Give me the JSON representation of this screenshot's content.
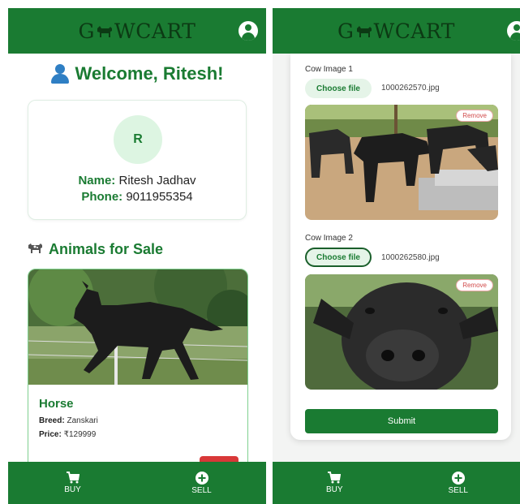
{
  "app": {
    "logo_prefix": "G",
    "logo_suffix": "WCART"
  },
  "bottom_nav": {
    "buy_label": "BUY",
    "sell_label": "SELL"
  },
  "left": {
    "welcome": "Welcome, Ritesh!",
    "profile": {
      "initial": "R",
      "name_label": "Name:",
      "name_value": "Ritesh Jadhav",
      "phone_label": "Phone:",
      "phone_value": "9011955354"
    },
    "section_title": "Animals for Sale",
    "listing": {
      "name": "Horse",
      "breed_label": "Breed:",
      "breed_value": "Zanskari",
      "price_label": "Price:",
      "price_value": "₹129999"
    }
  },
  "right": {
    "image1": {
      "label": "Cow Image 1",
      "button": "Choose file",
      "file_name": "1000262570.jpg",
      "remove": "Remove"
    },
    "image2": {
      "label": "Cow Image 2",
      "button": "Choose file",
      "file_name": "1000262580.jpg",
      "remove": "Remove"
    },
    "submit": "Submit"
  },
  "colors": {
    "brand": "#1a7b32",
    "brand_dark": "#0c3a14",
    "accent_light": "#ddf5e2",
    "danger": "#d93838"
  }
}
